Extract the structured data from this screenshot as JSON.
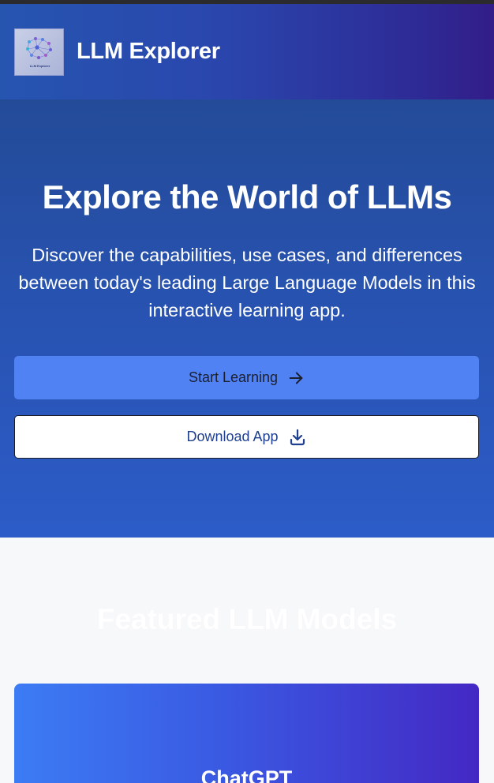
{
  "header": {
    "logo_text": "LLM Explorer",
    "title": "LLM Explorer"
  },
  "hero": {
    "title": "Explore the World of LLMs",
    "subtitle": "Discover the capabilities, use cases, and differences between today's leading Large Language Models in this interactive learning app.",
    "primary_button": "Start Learning",
    "secondary_button": "Download App"
  },
  "featured": {
    "title": "Featured LLM Models",
    "cards": [
      {
        "name": "ChatGPT"
      }
    ]
  },
  "icons": {
    "logo": "brain-network-icon",
    "primary_button": "arrow-right-icon",
    "secondary_button": "download-icon"
  },
  "colors": {
    "header_start": "#2655b0",
    "header_end": "#331d88",
    "hero_bg": "#2853b2",
    "primary_button": "#5182f3",
    "secondary_button_text": "#1f3f8f",
    "card_start": "#3c7cf4",
    "card_end": "#4428c4",
    "page_bg": "#f7f8fa"
  }
}
